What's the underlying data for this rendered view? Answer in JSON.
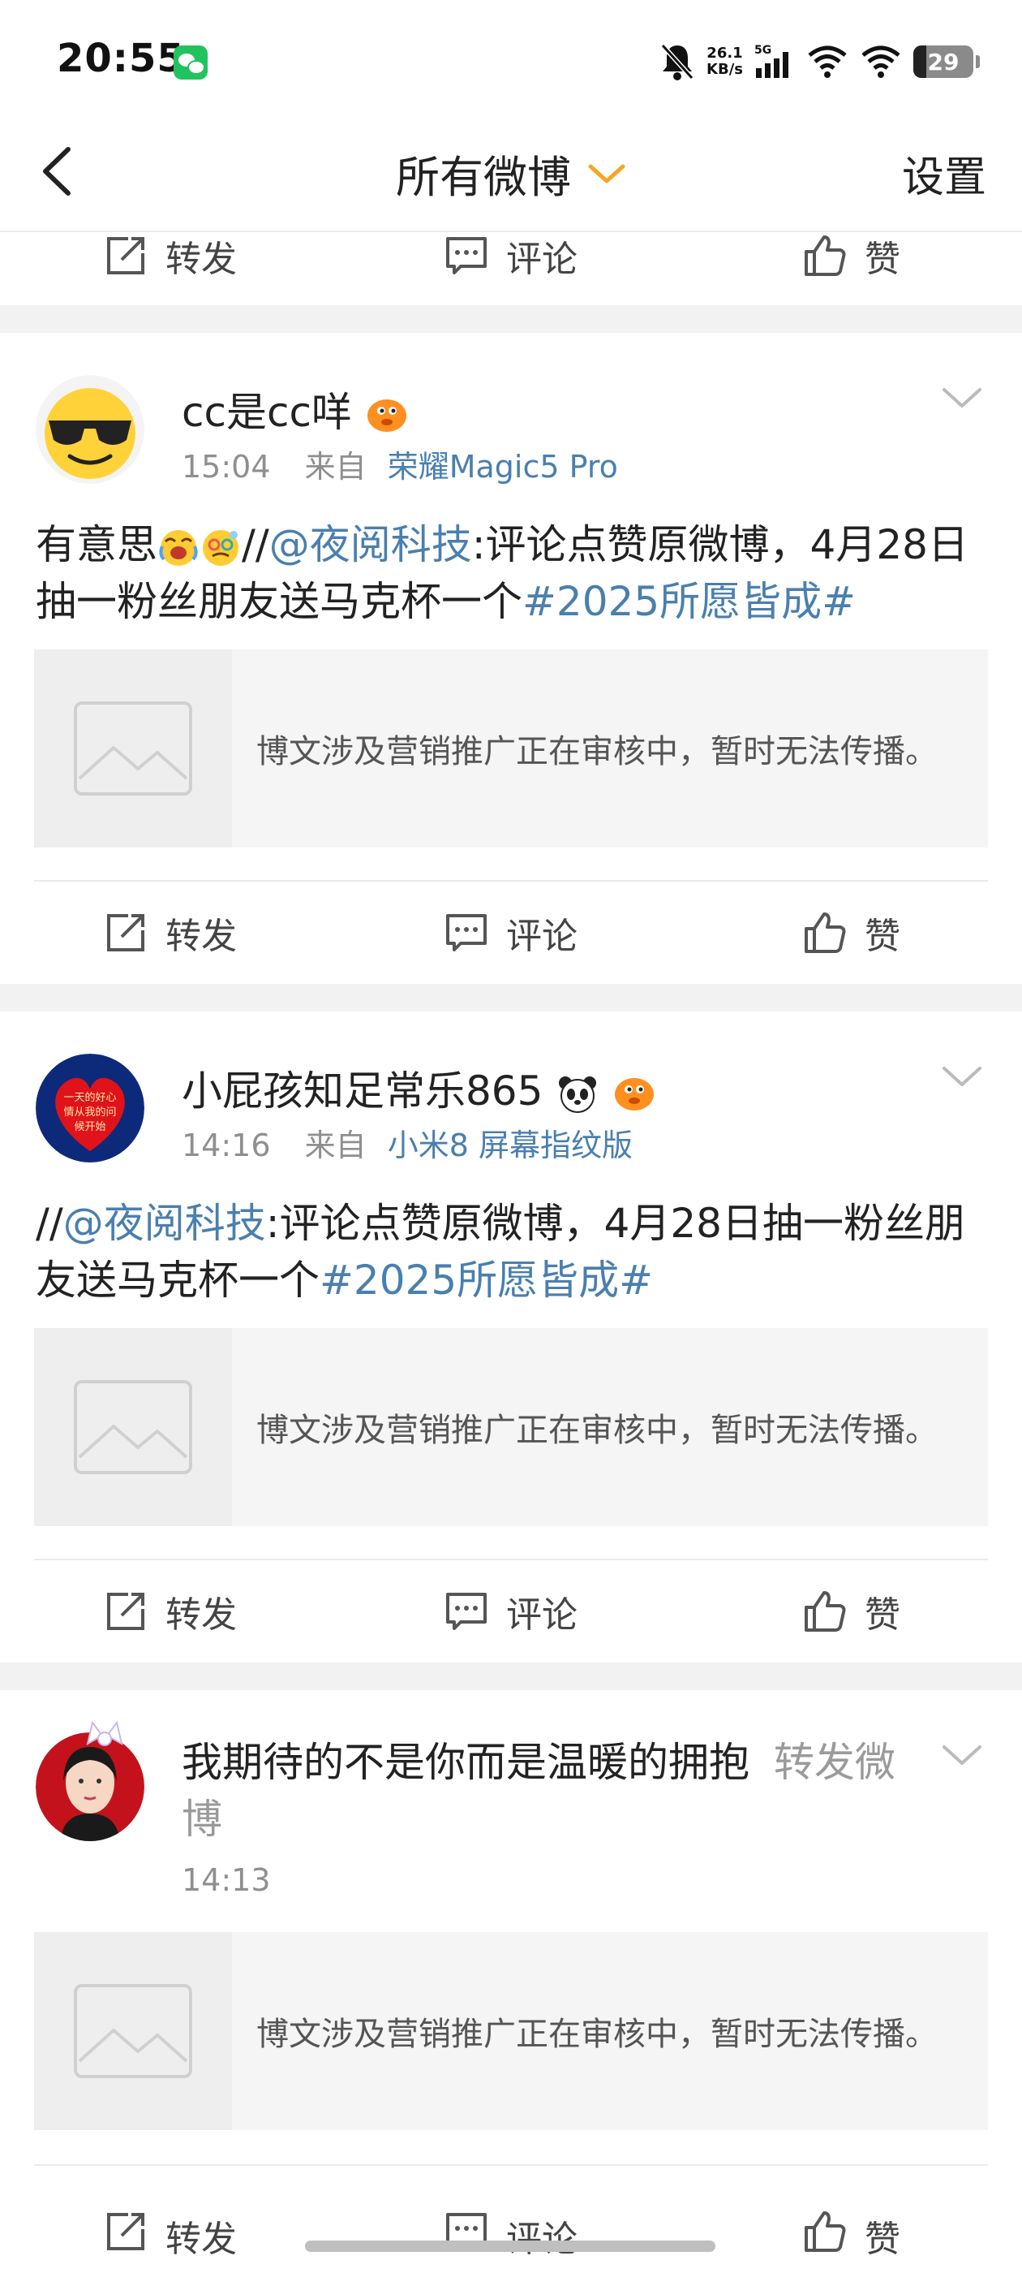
{
  "status_bar": {
    "time": "20:55",
    "net_speed_value": "26.1",
    "net_speed_unit": "KB/s",
    "network_type": "5G",
    "battery": "29"
  },
  "nav": {
    "title": "所有微博",
    "settings": "设置"
  },
  "actions": {
    "repost": "转发",
    "comment": "评论",
    "like": "赞"
  },
  "posts": [
    {
      "username": "cc是cc咩",
      "time": "15:04",
      "from_label": "来自",
      "source": "荣耀Magic5 Pro",
      "text_before": "有意思",
      "text_prefix": "//",
      "mention": "@夜阅科技",
      "text": ":评论点赞原微博，4月28日抽一粉丝朋友送马克杯一个",
      "hashtag": "#2025所愿皆成#",
      "card_text": "博文涉及营销推广正在审核中，暂时无法传播。"
    },
    {
      "username": "小屁孩知足常乐865",
      "time": "14:16",
      "from_label": "来自",
      "source": "小米8 屏幕指纹版",
      "avatar_text": "一天的好心情从我的问候开始",
      "text_prefix": "//",
      "mention": "@夜阅科技",
      "text": ":评论点赞原微博，4月28日抽一粉丝朋友送马克杯一个",
      "hashtag": "#2025所愿皆成#",
      "card_text": "博文涉及营销推广正在审核中，暂时无法传播。"
    },
    {
      "username": "我期待的不是你而是温暖的拥抱",
      "action_label": "转发微博",
      "time": "14:13",
      "card_text": "博文涉及营销推广正在审核中，暂时无法传播。"
    }
  ],
  "colors": {
    "link": "#4a7fae",
    "accent_orange": "#f5a623",
    "separator": "#f2f2f2"
  }
}
